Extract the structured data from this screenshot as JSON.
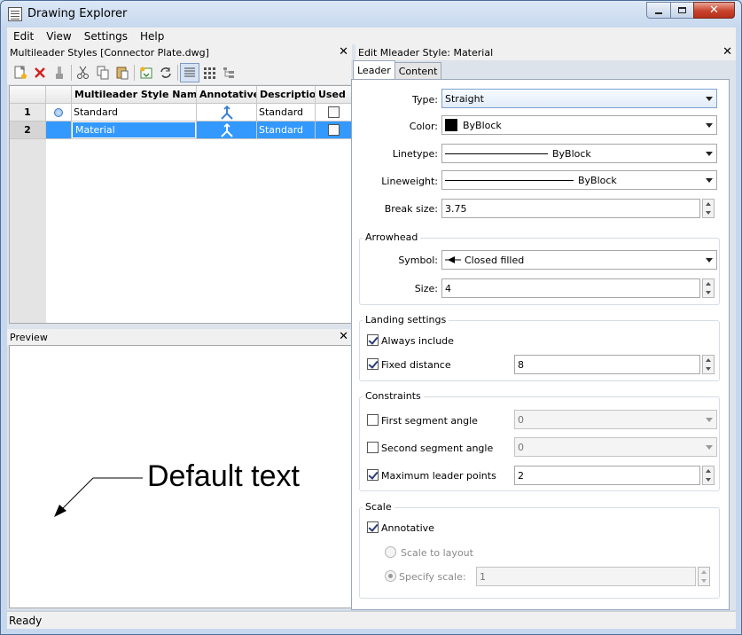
{
  "window": {
    "title": "Drawing Explorer"
  },
  "menu": [
    "Edit",
    "View",
    "Settings",
    "Help"
  ],
  "left_panel": {
    "title": "Multileader Styles [Connector Plate.dwg]",
    "columns": [
      "Multileader Style Name",
      "Annotative",
      "Description",
      "Used"
    ],
    "rows": [
      {
        "num": "1",
        "name": "Standard",
        "description": "Standard"
      },
      {
        "num": "2",
        "name": "Material",
        "description": "Standard"
      }
    ]
  },
  "preview": {
    "title": "Preview",
    "sample_text": "Default text"
  },
  "status": {
    "text": "Ready"
  },
  "right_panel": {
    "title": "Edit Mleader Style: Material",
    "tabs": [
      "Leader",
      "Content"
    ],
    "fields": {
      "type_label": "Type:",
      "type_value": "Straight",
      "color_label": "Color:",
      "color_value": "ByBlock",
      "linetype_label": "Linetype:",
      "linetype_value": "ByBlock",
      "lineweight_label": "Lineweight:",
      "lineweight_value": "ByBlock",
      "break_label": "Break size:",
      "break_value": "3.75"
    },
    "arrowhead": {
      "title": "Arrowhead",
      "symbol_label": "Symbol:",
      "symbol_value": "Closed filled",
      "size_label": "Size:",
      "size_value": "4"
    },
    "landing": {
      "title": "Landing settings",
      "always_include": "Always include",
      "fixed_distance": "Fixed distance",
      "fixed_distance_value": "8"
    },
    "constraints": {
      "title": "Constraints",
      "first_segment": "First segment angle",
      "first_value": "0",
      "second_segment": "Second segment angle",
      "second_value": "0",
      "max_points": "Maximum leader points",
      "max_value": "2"
    },
    "scale": {
      "title": "Scale",
      "annotative": "Annotative",
      "scale_to_layout": "Scale to layout",
      "specify_scale": "Specify scale:",
      "specify_value": "1"
    }
  },
  "colors": {
    "selection": "#3399ff",
    "accent_icon": "#3a7fd0"
  }
}
